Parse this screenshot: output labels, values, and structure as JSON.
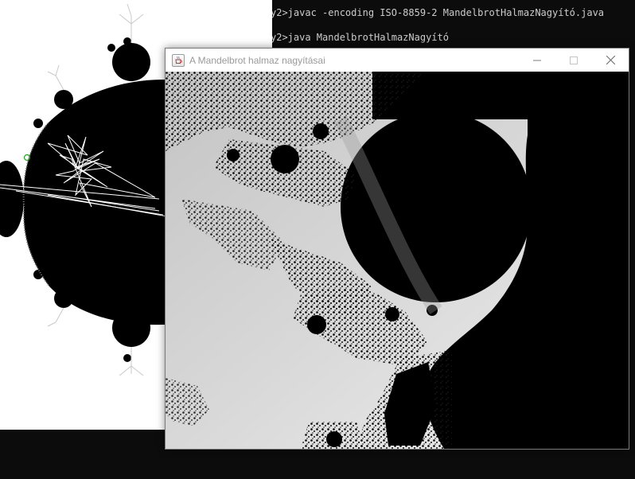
{
  "console": {
    "line1": "y2>javac -encoding ISO-8859-2 MandelbrotHalmazNagyító.java",
    "line2": "y2>java MandelbrotHalmazNagyító"
  },
  "window": {
    "title": "A Mandelbrot halmaz nagyításai",
    "icon": "java-cup-icon",
    "controls": {
      "minimize": "minimize-icon",
      "maximize": "maximize-icon",
      "close": "close-icon"
    }
  },
  "colors": {
    "console_bg": "#0c0c0c",
    "console_text": "#cccccc",
    "set_fill": "#000000",
    "canvas_bg": "#ffffff",
    "zoom_bg": "#d0d0d0",
    "title_text": "#9a9a9a"
  }
}
